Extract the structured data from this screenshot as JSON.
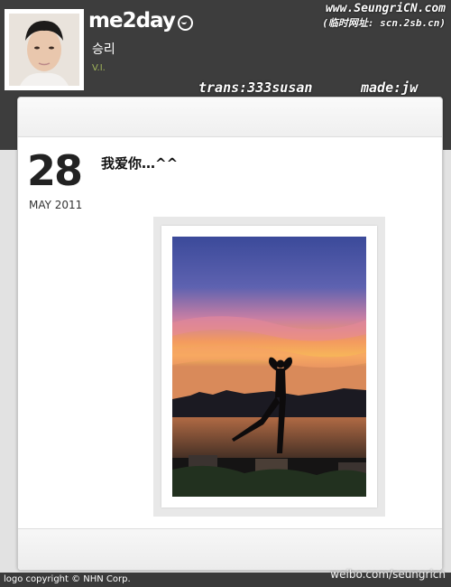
{
  "header": {
    "brand": "me2day",
    "user_name": "승리",
    "user_role": "V.I.",
    "site_url": "www.SeungriCN.com",
    "site_url_alt": "(临时网址: scn.2sb.cn)",
    "credit_trans": "trans:333susan",
    "credit_made": "made:jw"
  },
  "post": {
    "day": "28",
    "month_year": "MAY 2011",
    "text": "我爱你…^^"
  },
  "footer": {
    "logo_copyright": "logo copyright © NHN Corp.",
    "watermark": "weibo.com/seungricn"
  },
  "colors": {
    "topbar": "#3d3d3d",
    "role_accent": "#a0b45a"
  },
  "icons": {
    "brand_bubble": "speech-bubble-icon"
  }
}
